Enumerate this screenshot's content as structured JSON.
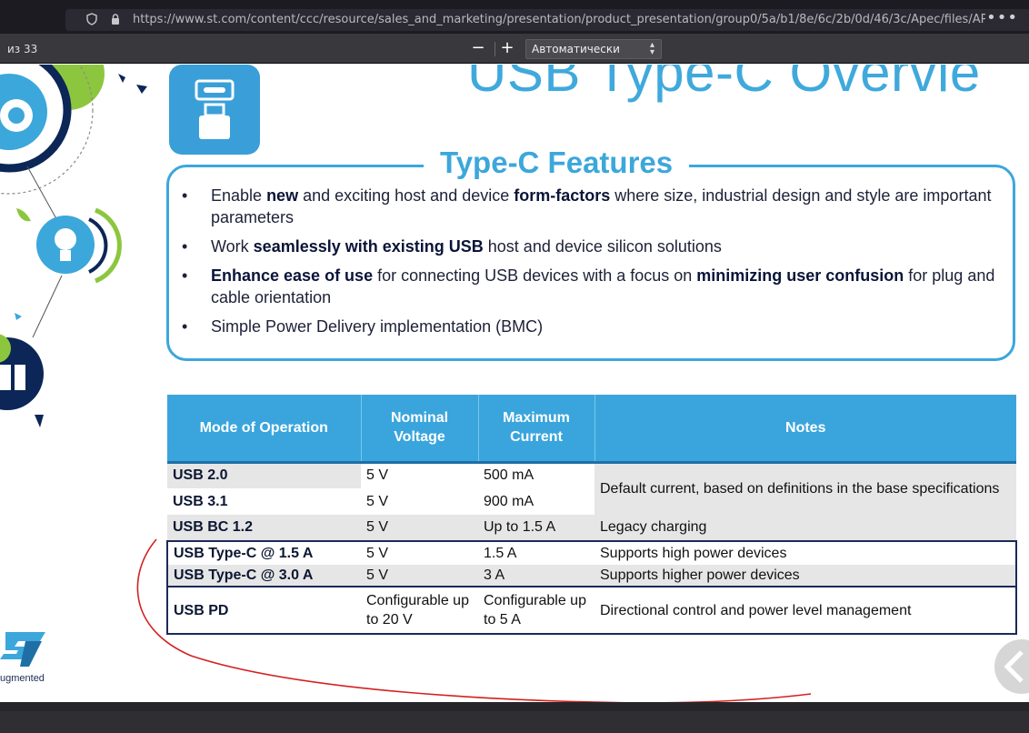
{
  "browser": {
    "url": "https://www.st.com/content/ccc/resource/sales_and_marketing/presentation/product_presentation/group0/5a/b1/8e/6c/2b/0d/46/3c/Apec/files/APEC_20",
    "menu_dots": "•••"
  },
  "pdf_toolbar": {
    "page_of": "из 33",
    "zoom_out": "−",
    "zoom_in": "+",
    "zoom_value": "Автоматически"
  },
  "slide": {
    "title": "USB Type-C Overvie",
    "features_title": "Type-C Features",
    "bullets": [
      {
        "parts": [
          {
            "t": "Enable ",
            "b": false
          },
          {
            "t": "new",
            "b": true
          },
          {
            "t": " and exciting host and device ",
            "b": false
          },
          {
            "t": "form-factors",
            "b": true
          },
          {
            "t": " where size, industrial design and style are important parameters",
            "b": false
          }
        ]
      },
      {
        "parts": [
          {
            "t": "Work ",
            "b": false
          },
          {
            "t": "seamlessly with existing USB",
            "b": true
          },
          {
            "t": " host and device silicon solutions",
            "b": false
          }
        ]
      },
      {
        "parts": [
          {
            "t": "Enhance ease of use",
            "b": true
          },
          {
            "t": " for connecting USB devices with a focus on ",
            "b": false
          },
          {
            "t": "minimizing user confusion",
            "b": true
          },
          {
            "t": " for plug and cable orientation",
            "b": false
          }
        ]
      },
      {
        "parts": [
          {
            "t": "Simple Power Delivery implementation (BMC)",
            "b": false
          }
        ]
      }
    ],
    "bullet_char": "•",
    "table": {
      "headers": [
        "Mode of Operation",
        "Nominal Voltage",
        "Maximum Current",
        "Notes"
      ],
      "rows": [
        {
          "mode": "USB 2.0",
          "voltage": "5 V",
          "current": "500 mA",
          "notes": "Default current, based on definitions in the base specifications"
        },
        {
          "mode": "USB 3.1",
          "voltage": "5 V",
          "current": "900 mA"
        },
        {
          "mode": "USB BC 1.2",
          "voltage": "5 V",
          "current": "Up to 1.5 A",
          "notes": "Legacy charging"
        },
        {
          "mode": "USB Type-C @ 1.5 A",
          "voltage": "5 V",
          "current": "1.5 A",
          "notes": "Supports high power devices"
        },
        {
          "mode": "USB Type-C @ 3.0 A",
          "voltage": "5 V",
          "current": "3 A",
          "notes": "Supports higher power devices"
        },
        {
          "mode": "USB PD",
          "voltage": "Configurable up to 20 V",
          "current": "Configurable up to 5 A",
          "notes": "Directional control and power level management"
        }
      ]
    },
    "logo_tagline": "ugmented"
  },
  "colors": {
    "accent": "#3ca7db",
    "navy": "#1a2a5a",
    "annotation": "#d42020"
  },
  "icons": [
    "shield-icon",
    "lock-icon",
    "usb-c-plug-icon",
    "lightbulb-icon",
    "battery-icon",
    "st-logo-icon",
    "next-page-icon"
  ]
}
